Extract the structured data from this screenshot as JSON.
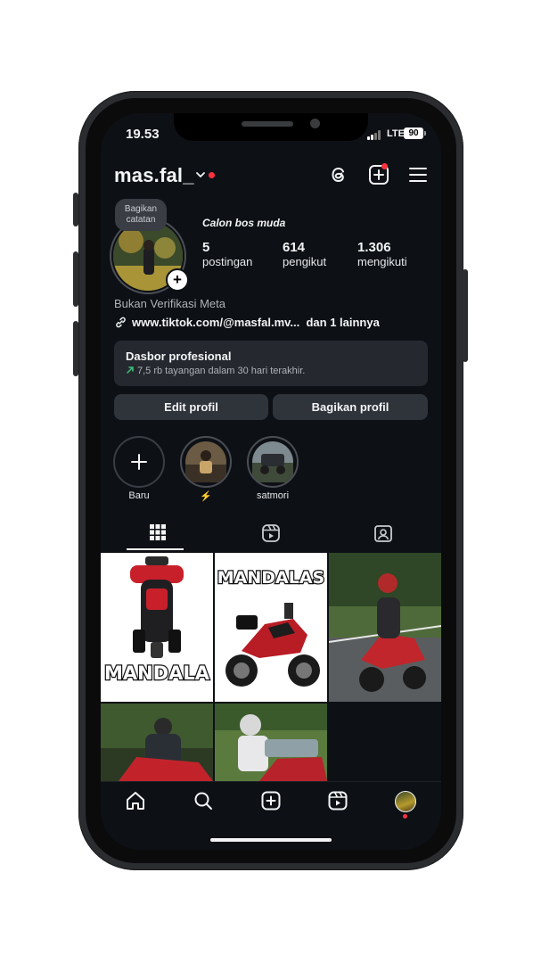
{
  "status_bar": {
    "time": "19.53",
    "network": "LTE",
    "battery": "90"
  },
  "header": {
    "username": "mas.fal_"
  },
  "profile": {
    "note": "Bagikan catatan",
    "name": "Calon bos muda",
    "stats": [
      {
        "value": "5",
        "label": "postingan"
      },
      {
        "value": "614",
        "label": "pengikut"
      },
      {
        "value": "1.306",
        "label": "mengikuti"
      }
    ],
    "meta_label": "Bukan Verifikasi Meta",
    "link": "www.tiktok.com/@masfal.mv...",
    "link_more": "dan 1 lainnya"
  },
  "dashboard": {
    "title": "Dasbor profesional",
    "subtitle": "7,5 rb tayangan dalam 30 hari terakhir."
  },
  "buttons": {
    "edit": "Edit profil",
    "share": "Bagikan profil"
  },
  "highlights": [
    {
      "label": "Baru"
    },
    {
      "label": "⚡"
    },
    {
      "label": "satmori"
    }
  ],
  "tabs": [
    "grid-icon",
    "reels-icon",
    "tagged-icon"
  ],
  "grid_images": [
    {
      "text": "MANDALA"
    },
    {
      "text": "MANDALAS"
    }
  ],
  "colors": {
    "background": "#0d1015",
    "accent_red": "#ff3040",
    "trend_green": "#3cc27a"
  }
}
